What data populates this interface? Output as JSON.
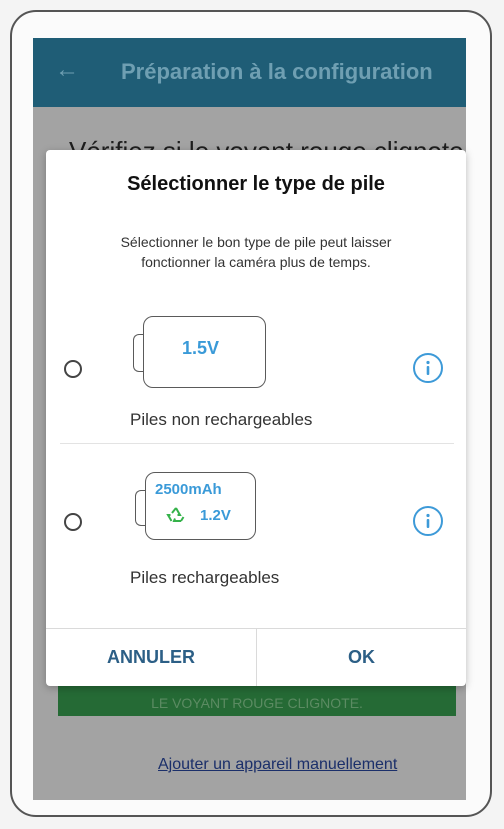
{
  "app_bar": {
    "back_icon": "arrow-left-icon",
    "title": "Préparation à la configuration"
  },
  "background": {
    "heading": "Vérifiez si le voyant rouge clignote",
    "green_button": "LE VOYANT ROUGE CLIGNOTE.",
    "link": "Ajouter un appareil manuellement"
  },
  "dialog": {
    "title": "Sélectionner le type de pile",
    "description_line1": "Sélectionner le bon type de pile peut laisser",
    "description_line2": "fonctionner la caméra plus de temps.",
    "options": [
      {
        "battery_voltage": "1.5V",
        "label": "Piles non rechargeables",
        "selected": false,
        "info_icon": "info-icon"
      },
      {
        "battery_capacity": "2500mAh",
        "battery_voltage": "1.2V",
        "recycle_icon": "recycle-icon",
        "label": "Piles rechargeables",
        "selected": false,
        "info_icon": "info-icon"
      }
    ],
    "cancel_label": "ANNULER",
    "ok_label": "OK"
  },
  "colors": {
    "app_bar": "#1f5d76",
    "accent_blue": "#3a9ad8",
    "recycle_green": "#35b24a",
    "button_text": "#2c5f86"
  }
}
